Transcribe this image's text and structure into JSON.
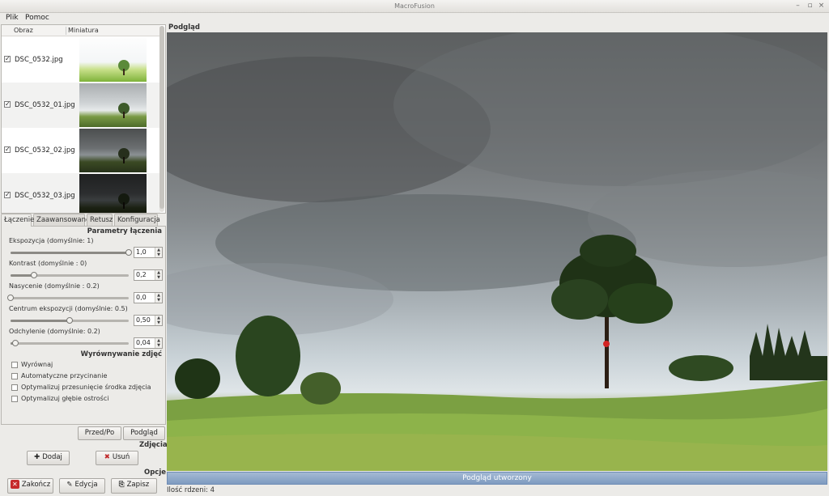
{
  "window": {
    "title": "MacroFusion"
  },
  "menu": {
    "items": [
      "Plik",
      "Pomoc"
    ]
  },
  "filelist": {
    "columns": [
      "Obraz",
      "Miniatura"
    ],
    "rows": [
      {
        "name": "DSC_0532.jpg",
        "checked": true
      },
      {
        "name": "DSC_0532_01.jpg",
        "checked": true
      },
      {
        "name": "DSC_0532_02.jpg",
        "checked": true
      },
      {
        "name": "DSC_0532_03.jpg",
        "checked": true
      }
    ]
  },
  "tabs": [
    "Łączenie",
    "Zaawansowane",
    "Retusz",
    "Konfiguracja"
  ],
  "blend": {
    "section_title": "Parametry łączenia",
    "params": [
      {
        "label": "Ekspozycja (domyślnie: 1)",
        "value": "1,0",
        "fraction": 1.0
      },
      {
        "label": "Kontrast (domyślnie : 0)",
        "value": "0,2",
        "fraction": 0.2
      },
      {
        "label": "Nasycenie (domyślnie : 0.2)",
        "value": "0,0",
        "fraction": 0.0
      },
      {
        "label": "Centrum ekspozycji (domyślnie: 0.5)",
        "value": "0,50",
        "fraction": 0.5
      },
      {
        "label": "Odchylenie (domyślnie: 0.2)",
        "value": "0,04",
        "fraction": 0.04
      }
    ]
  },
  "align": {
    "section_title": "Wyrównywanie zdjęć",
    "options": [
      "Wyrównaj",
      "Automatyczne przycinanie",
      "Optymalizuj przesunięcie środka zdjęcia",
      "Optymalizuj głębie ostrości"
    ]
  },
  "buttons": {
    "before_after": "Przed/Po",
    "preview": "Podgląd",
    "add": "Dodaj",
    "remove": "Usuń",
    "quit": "Zakończ",
    "edit": "Edycja",
    "save": "Zapisz"
  },
  "sections": {
    "photos": "Zdjęcia",
    "options": "Opcje"
  },
  "preview": {
    "label": "Podgląd",
    "status": "Podgląd utworzony"
  },
  "statusbar": {
    "cores": "Ilość rdzeni: 4"
  }
}
